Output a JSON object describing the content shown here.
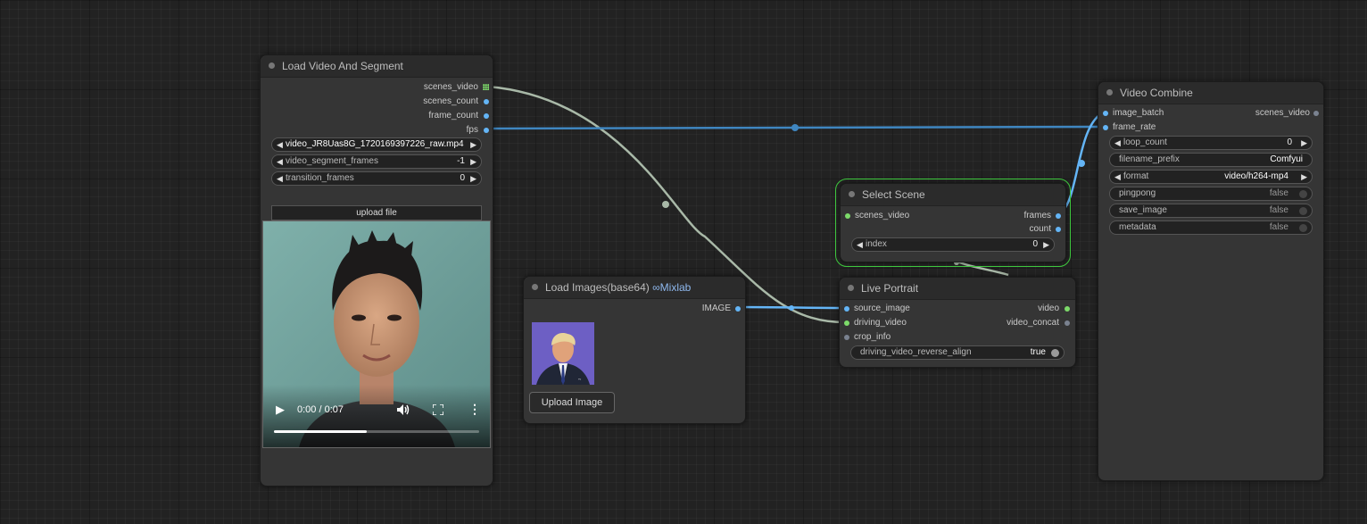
{
  "colors": {
    "canvas": "#222222",
    "node_bg": "#353535",
    "node_title": "#2b2b2b",
    "wire_image": "#a9b9a8",
    "wire_int": "#4a90c8",
    "selected_outline": "#3ec73e"
  },
  "load_video": {
    "title": "Load Video And Segment",
    "outputs": [
      "scenes_video",
      "scenes_count",
      "frame_count",
      "fps"
    ],
    "video_file": "video_JR8Uas8G_1720169397226_raw.mp4",
    "segment_frames": {
      "label": "video_segment_frames",
      "value": "-1"
    },
    "transition_frames": {
      "label": "transition_frames",
      "value": "0"
    },
    "upload_label": "upload file",
    "player": {
      "time": "0:00 / 0:07",
      "progress": 0.45,
      "play_icon": "play-icon",
      "volume_icon": "volume-icon",
      "fullscreen_icon": "fullscreen-icon",
      "menu_icon": "more-vert-icon"
    }
  },
  "load_images": {
    "title": "Load Images(base64)",
    "title_suffix": "Mixlab",
    "title_suffix_icon": "infinity-icon",
    "output": "IMAGE",
    "upload_label": "Upload Image"
  },
  "select_scene": {
    "title": "Select Scene",
    "input": "scenes_video",
    "outputs": [
      "frames",
      "count"
    ],
    "index": {
      "label": "index",
      "value": "0"
    }
  },
  "live_portrait": {
    "title": "Live Portrait",
    "inputs": [
      "source_image",
      "driving_video",
      "crop_info"
    ],
    "outputs": [
      "video",
      "video_concat"
    ],
    "reverse_align": {
      "label": "driving_video_reverse_align",
      "value": "true"
    }
  },
  "video_combine": {
    "title": "Video Combine",
    "inputs": [
      "image_batch",
      "frame_rate"
    ],
    "output": "scenes_video",
    "loop_count": {
      "label": "loop_count",
      "value": "0"
    },
    "filename_prefix": {
      "label": "filename_prefix",
      "value": "Comfyui"
    },
    "format": {
      "label": "format",
      "value": "video/h264-mp4"
    },
    "pingpong": {
      "label": "pingpong",
      "value": "false"
    },
    "save_image": {
      "label": "save_image",
      "value": "false"
    },
    "metadata": {
      "label": "metadata",
      "value": "false"
    }
  }
}
